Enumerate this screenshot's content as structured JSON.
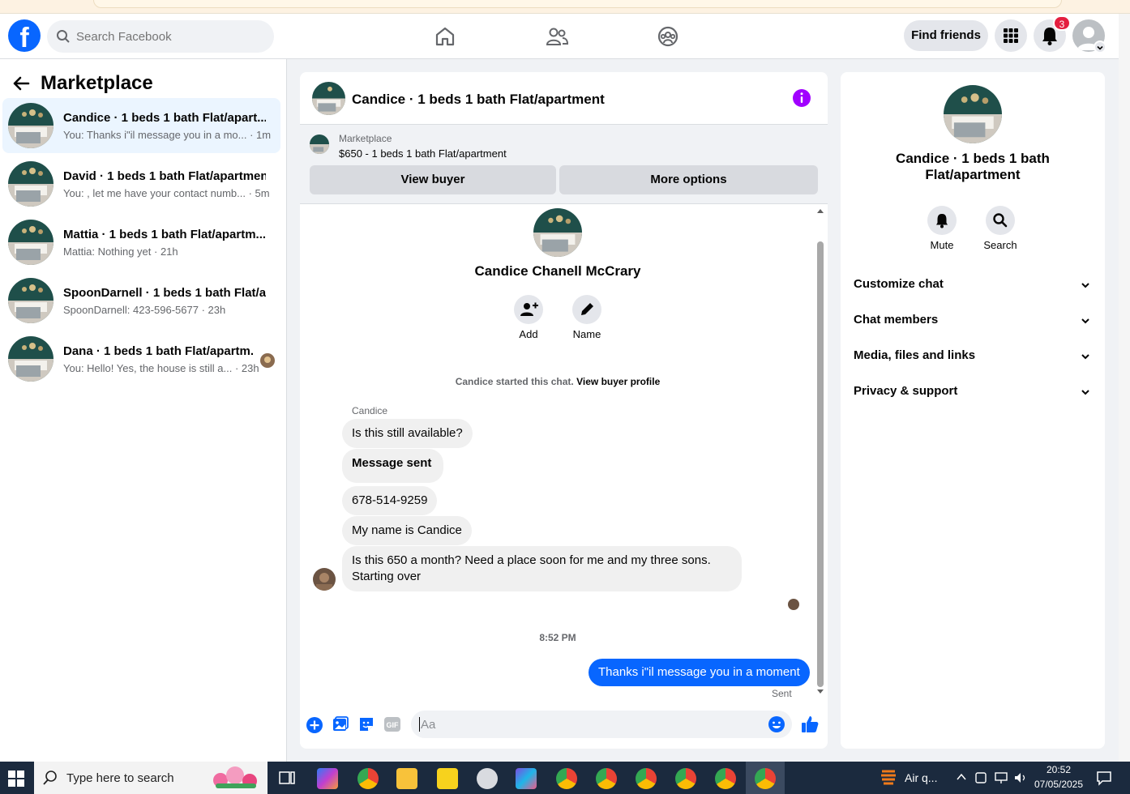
{
  "header": {
    "logo": "f",
    "search_placeholder": "Search Facebook",
    "find_friends": "Find friends",
    "notifications_count": "3",
    "nav_icons": [
      "home-icon",
      "friends-icon",
      "groups-icon"
    ]
  },
  "sidebar": {
    "title": "Marketplace",
    "conversations": [
      {
        "title": "Candice · 1 beds 1 bath Flat/apart...",
        "snippet": "You: Thanks i\"il message you in a mo... · 1m"
      },
      {
        "title": "David · 1 beds 1 bath Flat/apartment",
        "snippet": "You: , let me have your contact numb... · 5m"
      },
      {
        "title": "Mattia · 1 beds 1 bath Flat/apartm...",
        "snippet": "Mattia: Nothing yet · 21h"
      },
      {
        "title": "SpoonDarnell · 1 beds 1 bath Flat/a...",
        "snippet": "SpoonDarnell: 423-596-5677 · 23h"
      },
      {
        "title": "Dana · 1 beds 1 bath Flat/apartm...",
        "snippet": "You: Hello! Yes, the house is still a... · 23h"
      }
    ]
  },
  "chat": {
    "title": "Candice · 1 beds 1 bath Flat/apartment",
    "marketplace_label": "Marketplace",
    "listing": "$650 - 1 beds 1 bath Flat/apartment",
    "view_buyer": "View buyer",
    "more_options": "More options",
    "profile_name": "Candice Chanell McCrary",
    "add_label": "Add",
    "name_label": "Name",
    "started_text": "Candice started this chat.",
    "view_buyer_profile": "View buyer profile",
    "sender_name": "Candice",
    "messages": [
      "Is this still available?",
      "Message sent",
      "678-514-9259",
      "My name is Candice",
      "Is this 650 a month? Need a place soon for me and my three sons. Starting over"
    ],
    "time": "8:52 PM",
    "my_message": "Thanks i\"il message you in a moment",
    "sent_status": "Sent",
    "composer_placeholder": "Aa"
  },
  "details": {
    "title": "Candice · 1 beds 1 bath Flat/apartment",
    "mute": "Mute",
    "search": "Search",
    "sections": [
      "Customize chat",
      "Chat members",
      "Media, files and links",
      "Privacy & support"
    ]
  },
  "taskbar": {
    "search_placeholder": "Type here to search",
    "weather": "Air q...",
    "time": "20:52",
    "date": "07/05/2025"
  },
  "colors": {
    "accent": "#0866ff",
    "badge": "#e41e3f",
    "info": "#a100ff"
  }
}
